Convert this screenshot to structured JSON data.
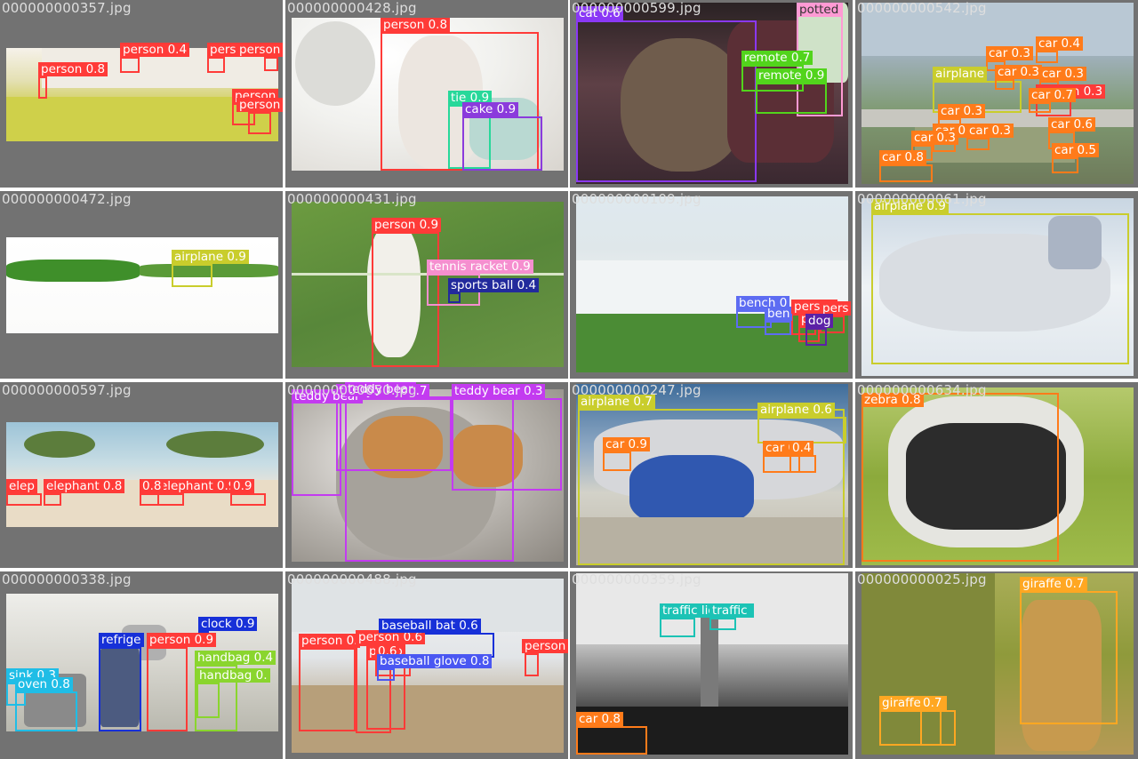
{
  "colors": {
    "person": "#ff3b38",
    "car": "#ff7b1a",
    "airplane": "#c9cd2c",
    "cat": "#8a38f5",
    "remote": "#52d41c",
    "tie": "#27d89a",
    "cake": "#8b3bdc",
    "potted": "#ff9ad4",
    "tennis racket": "#f58fcf",
    "sports ball": "#222a9c",
    "bench": "#5d6cf2",
    "dog": "#5c21a6",
    "elephant": "#ff3b38",
    "teddy bear": "#c33bf0",
    "zebra": "#ff7b1a",
    "clock": "#1730d8",
    "refrigerator": "#1730d8",
    "handbag": "#8ad52e",
    "sink": "#1fbde6",
    "oven": "#1fbde6",
    "baseball bat": "#1730d8",
    "baseball glove": "#4a57f2",
    "traffic light": "#1cc3b5",
    "giraffe": "#ffa722"
  },
  "tiles": [
    {
      "filename": "000000000357.jpg",
      "detections": [
        {
          "label": "person 0.4",
          "cls": "person"
        },
        {
          "label": "person 0.7",
          "cls": "person"
        },
        {
          "label": "person 0.8",
          "cls": "person"
        },
        {
          "label": "person",
          "cls": "person"
        },
        {
          "label": "person",
          "cls": "person"
        },
        {
          "label": "person",
          "cls": "person"
        }
      ]
    },
    {
      "filename": "000000000428.jpg",
      "detections": [
        {
          "label": "person 0.8",
          "cls": "person"
        },
        {
          "label": "tie 0.9",
          "cls": "tie"
        },
        {
          "label": "cake 0.9",
          "cls": "cake"
        }
      ]
    },
    {
      "filename": "000000000599.jpg",
      "detections": [
        {
          "label": "cat 0.6",
          "cls": "cat"
        },
        {
          "label": "potted",
          "cls": "potted"
        },
        {
          "label": "remote 0.7",
          "cls": "remote"
        },
        {
          "label": "remote 0.9",
          "cls": "remote"
        }
      ]
    },
    {
      "filename": "000000000542.jpg",
      "detections": [
        {
          "label": "car 0.4",
          "cls": "car"
        },
        {
          "label": "car 0.3",
          "cls": "car"
        },
        {
          "label": "airplane",
          "cls": "airplane"
        },
        {
          "label": "car 0.3",
          "cls": "car"
        },
        {
          "label": "car 0.3",
          "cls": "car"
        },
        {
          "label": "person 0.3",
          "cls": "person"
        },
        {
          "label": "car 0.7",
          "cls": "car"
        },
        {
          "label": "car 0.3",
          "cls": "car"
        },
        {
          "label": "car 0.3",
          "cls": "car"
        },
        {
          "label": "car 0.3",
          "cls": "car"
        },
        {
          "label": "car 0.6",
          "cls": "car"
        },
        {
          "label": "car 0.3",
          "cls": "car"
        },
        {
          "label": "car 0.8",
          "cls": "car"
        },
        {
          "label": "car 0.5",
          "cls": "car"
        }
      ]
    },
    {
      "filename": "000000000472.jpg",
      "detections": [
        {
          "label": "airplane 0.9",
          "cls": "airplane"
        }
      ]
    },
    {
      "filename": "000000000431.jpg",
      "detections": [
        {
          "label": "person 0.9",
          "cls": "person"
        },
        {
          "label": "tennis racket 0.9",
          "cls": "tennis racket"
        },
        {
          "label": "sports ball 0.4",
          "cls": "sports ball"
        }
      ]
    },
    {
      "filename": "000000000109.jpg",
      "detections": [
        {
          "label": "bench 0",
          "cls": "bench"
        },
        {
          "label": "ben",
          "cls": "bench"
        },
        {
          "label": "person",
          "cls": "person"
        },
        {
          "label": "pers",
          "cls": "person"
        },
        {
          "label": "pers",
          "cls": "person"
        },
        {
          "label": "dog",
          "cls": "dog"
        }
      ]
    },
    {
      "filename": "000000000061.jpg",
      "detections": [
        {
          "label": "airplane 0.9",
          "cls": "airplane"
        }
      ]
    },
    {
      "filename": "000000000597.jpg",
      "detections": [
        {
          "label": "elephant 0.8",
          "cls": "elephant"
        },
        {
          "label": "elephant 0.9",
          "cls": "elephant"
        },
        {
          "label": "elep",
          "cls": "elephant"
        },
        {
          "label": "0.9",
          "cls": "elephant"
        },
        {
          "label": "0.8",
          "cls": "elephant"
        }
      ]
    },
    {
      "filename": "000000000650.jpg",
      "detections": [
        {
          "label": "teddy bear 0.7",
          "cls": "teddy bear"
        },
        {
          "label": "teddy bear 0.3",
          "cls": "teddy bear"
        },
        {
          "label": "teddy bear",
          "cls": "teddy bear"
        },
        {
          "label": "teddy bear",
          "cls": "teddy bear"
        }
      ]
    },
    {
      "filename": "000000000247.jpg",
      "detections": [
        {
          "label": "airplane 0.7",
          "cls": "airplane"
        },
        {
          "label": "airplane 0.6",
          "cls": "airplane"
        },
        {
          "label": "car 0.9",
          "cls": "car"
        },
        {
          "label": "car 0.3",
          "cls": "car"
        },
        {
          "label": "0.4",
          "cls": "car"
        }
      ]
    },
    {
      "filename": "000000000634.jpg",
      "detections": [
        {
          "label": "zebra 0.8",
          "cls": "zebra"
        }
      ]
    },
    {
      "filename": "000000000338.jpg",
      "detections": [
        {
          "label": "clock 0.9",
          "cls": "clock"
        },
        {
          "label": "refrige",
          "cls": "refrigerator"
        },
        {
          "label": "person 0.9",
          "cls": "person"
        },
        {
          "label": "handbag 0.4",
          "cls": "handbag"
        },
        {
          "label": "sink 0.3",
          "cls": "sink"
        },
        {
          "label": "oven 0.8",
          "cls": "oven"
        },
        {
          "label": "handbag 0.",
          "cls": "handbag"
        }
      ]
    },
    {
      "filename": "000000000488.jpg",
      "detections": [
        {
          "label": "person 0.",
          "cls": "person"
        },
        {
          "label": "person 0.6",
          "cls": "person"
        },
        {
          "label": "baseball bat 0.6",
          "cls": "baseball bat"
        },
        {
          "label": "person",
          "cls": "person"
        },
        {
          "label": "perso",
          "cls": "person"
        },
        {
          "label": "0.6",
          "cls": "person"
        },
        {
          "label": "baseball glove 0.8",
          "cls": "baseball glove"
        }
      ]
    },
    {
      "filename": "000000000359.jpg",
      "detections": [
        {
          "label": "traffic light 0.9",
          "cls": "traffic light"
        },
        {
          "label": "traffic",
          "cls": "traffic light"
        },
        {
          "label": "car 0.8",
          "cls": "car"
        }
      ]
    },
    {
      "filename": "000000000025.jpg",
      "detections": [
        {
          "label": "giraffe 0.7",
          "cls": "giraffe"
        },
        {
          "label": "giraffe 0.3",
          "cls": "giraffe"
        },
        {
          "label": "0.7",
          "cls": "giraffe"
        }
      ]
    }
  ]
}
